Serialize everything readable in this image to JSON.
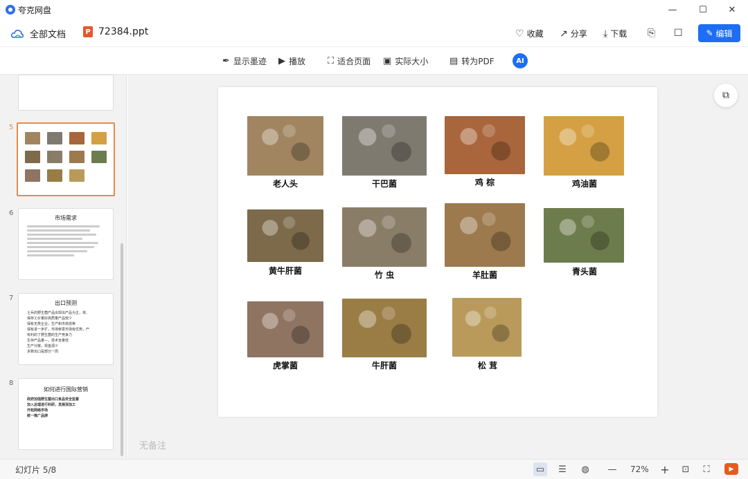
{
  "window": {
    "app_title": "夸克网盘",
    "minimize": "—",
    "maximize": "☐",
    "close": "✕"
  },
  "header": {
    "breadcrumb_root": "全部文档",
    "file_icon": "P",
    "file_name": "72384.ppt"
  },
  "actions": {
    "favorite": "收藏",
    "share": "分享",
    "download": "下载",
    "edit": "编辑"
  },
  "view_toolbar": {
    "show_ink": "显示墨迹",
    "play": "播放",
    "fit_page": "适合页面",
    "actual_size": "实际大小",
    "to_pdf": "转为PDF",
    "ai": "AI"
  },
  "sidebar": {
    "slides": [
      {
        "num": "5",
        "active": true
      },
      {
        "num": "6",
        "title": "市场需求"
      },
      {
        "num": "7",
        "title": "出口预测",
        "bullets": [
          "士兵的野生菌产品出现出产品为主，将、",
          "保存工价量好高质量产品较少",
          "保有无类企业，生产和市高低等",
          "保有进一步扩，市场参更市场有优势，产",
          "有利的了野生菌的生产竞争力",
          "生存产品量—，技术含量低",
          "生产分散，现金源少",
          "多数出口是部分一周"
        ]
      },
      {
        "num": "8",
        "title": "如何进行国际营销",
        "bullets": [
          "政府加强野生菌出口食品安全监督",
          "加入总理进行科研，发展深加工",
          "开拓网络市场",
          "统一推广品牌"
        ]
      }
    ]
  },
  "slide": {
    "mushrooms": [
      {
        "name": "老人头",
        "color": "#a08560"
      },
      {
        "name": "干巴菌",
        "color": "#7f7a70"
      },
      {
        "name": "鸡  棕",
        "color": "#a9653b"
      },
      {
        "name": "鸡油菌",
        "color": "#d4a043"
      },
      {
        "name": "黄牛肝菌",
        "color": "#7c6a4a"
      },
      {
        "name": "竹  虫",
        "color": "#8a7d68"
      },
      {
        "name": "羊肚菌",
        "color": "#9c7a4e"
      },
      {
        "name": "青头菌",
        "color": "#6d7c4c"
      },
      {
        "name": "虎掌菌",
        "color": "#8f7462"
      },
      {
        "name": "牛肝菌",
        "color": "#9a7c45"
      },
      {
        "name": "松  茸",
        "color": "#b99a5b"
      }
    ]
  },
  "notes": {
    "placeholder": "无备注"
  },
  "status": {
    "slide_counter": "幻灯片 5/8",
    "zoom": "72%"
  }
}
